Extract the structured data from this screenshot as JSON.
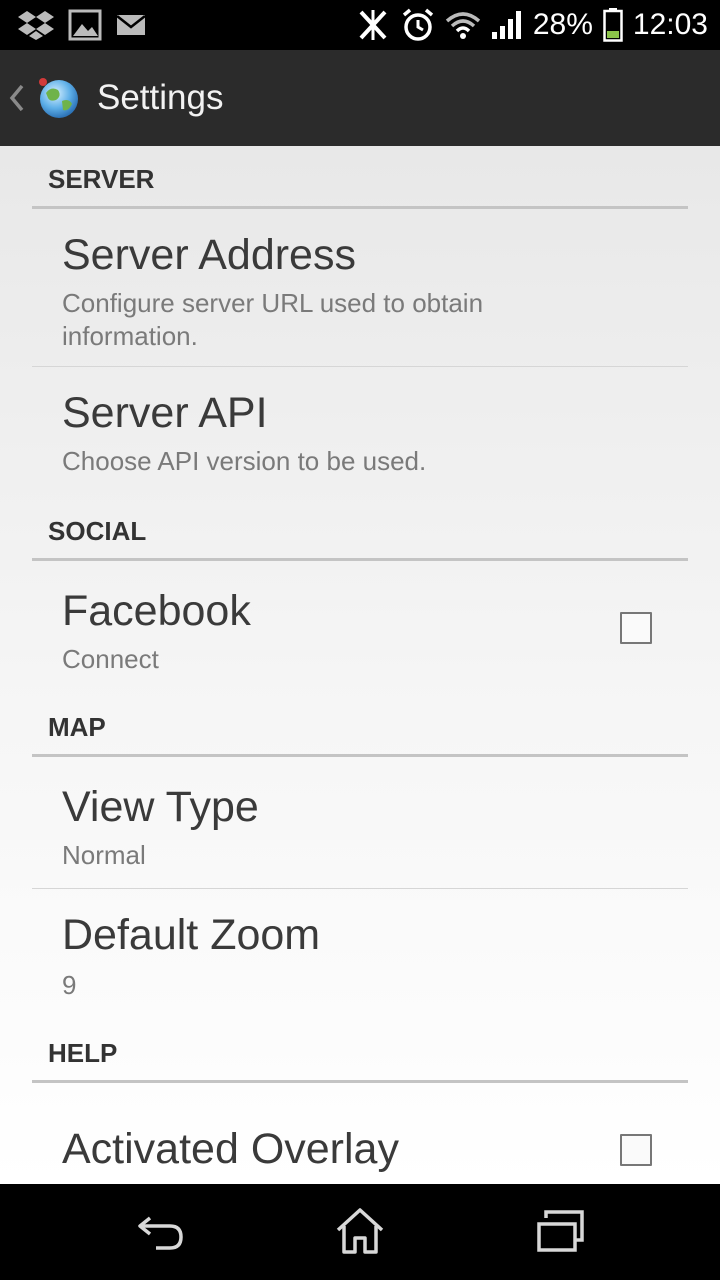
{
  "status_bar": {
    "icons_left": [
      "dropbox-icon",
      "image-icon",
      "mail-icon"
    ],
    "icons_right": [
      "nfc-icon",
      "alarm-icon",
      "wifi-icon",
      "signal-icon"
    ],
    "battery_percent": "28%",
    "battery_level": 0.28,
    "time": "12:03"
  },
  "action_bar": {
    "title": "Settings",
    "up_icon": "chevron-left-icon",
    "logo_icon": "globe-icon"
  },
  "sections": {
    "server": {
      "header": "SERVER",
      "items": [
        {
          "title": "Server Address",
          "summary": "Configure server URL used to obtain information."
        },
        {
          "title": "Server API",
          "summary": "Choose API version to be used."
        }
      ]
    },
    "social": {
      "header": "SOCIAL",
      "items": [
        {
          "title": "Facebook",
          "summary": "Connect",
          "checked": false
        }
      ]
    },
    "map": {
      "header": "MAP",
      "items": [
        {
          "title": "View Type",
          "summary": "Normal"
        },
        {
          "title": "Default Zoom",
          "summary": "9"
        }
      ]
    },
    "help": {
      "header": "HELP",
      "items": [
        {
          "title": "Activated Overlay",
          "checked": false
        }
      ]
    }
  },
  "nav_bar": {
    "buttons": [
      "back-icon",
      "home-icon",
      "recent-apps-icon"
    ]
  },
  "colors": {
    "action_bar_bg": "#2b2b2b",
    "status_bar_bg": "#000000",
    "battery_fill": "#8bc34a"
  }
}
